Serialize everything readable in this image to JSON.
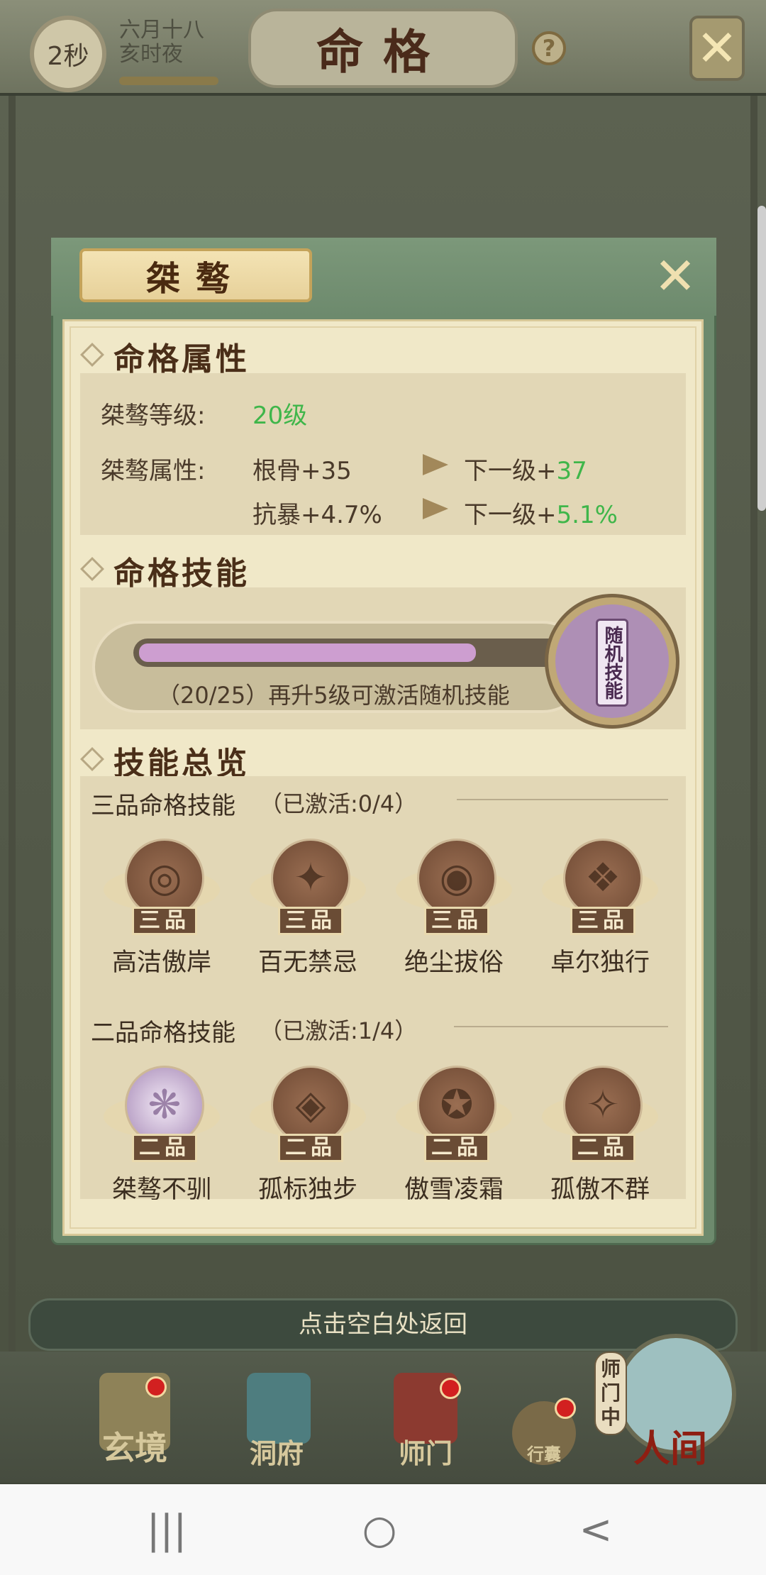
{
  "header": {
    "timer": "2秒",
    "date_line1": "六月十八",
    "date_line2": "亥时夜",
    "title": "命格",
    "help_icon": "?",
    "close_icon": "close-icon"
  },
  "modal": {
    "title": "桀骜",
    "attributes": {
      "section_title": "命格属性",
      "level_label": "桀骜等级:",
      "level_value": "20级",
      "attr_label": "桀骜属性:",
      "rows": [
        {
          "current": "根骨+35",
          "next_prefix": "下一级+",
          "next_value": "37"
        },
        {
          "current": "抗暴+4.7%",
          "next_prefix": "下一级+",
          "next_value": "5.1%"
        }
      ]
    },
    "skill": {
      "section_title": "命格技能",
      "progress_text": "（20/25）再升5级可激活随机技能",
      "progress_fraction": 0.8,
      "random_skill_label": "随机技能"
    },
    "overview": {
      "section_title": "技能总览",
      "tier3_title": "三品命格技能",
      "tier3_status": "（已激活:0/4）",
      "tier3_grade": "三品",
      "tier3_skills": [
        "高洁傲岸",
        "百无禁忌",
        "绝尘拔俗",
        "卓尔独行"
      ],
      "tier2_title": "二品命格技能",
      "tier2_status": "（已激活:1/4）",
      "tier2_grade": "二品",
      "tier2_skills": [
        "桀骜不驯",
        "孤标独步",
        "傲雪凌霜",
        "孤傲不群"
      ]
    }
  },
  "hint": "点击空白处返回",
  "nav": {
    "xuanjing": "玄境",
    "dongfu": "洞府",
    "shimen": "师门",
    "xingnang": "行囊",
    "renjian": "人间",
    "shimen_zhong": "师门中"
  },
  "system_nav": {
    "recents": "|||",
    "home": "○",
    "back": "<"
  }
}
